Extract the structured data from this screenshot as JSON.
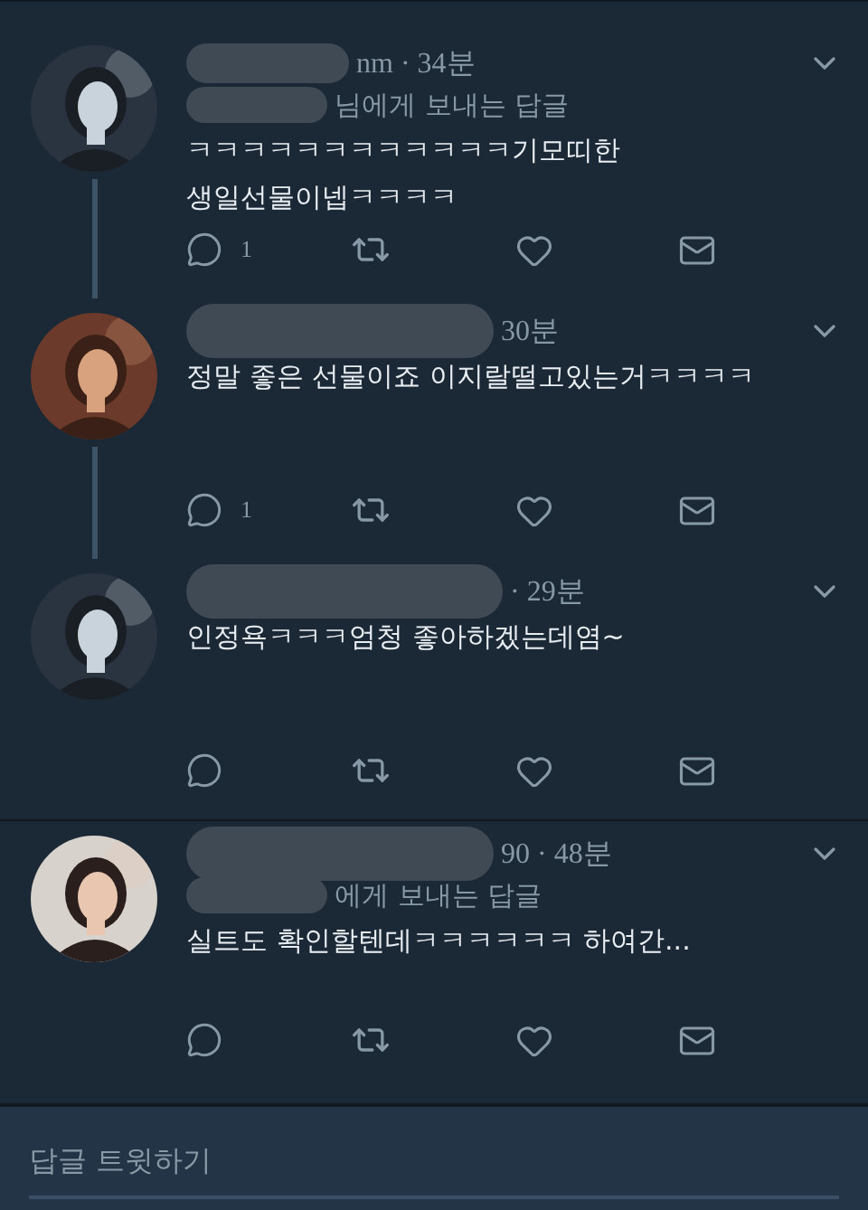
{
  "conversations": [
    {
      "tweets": [
        {
          "meta": "nm · 34분",
          "reply_to": "님에게 보내는 답글",
          "text": "ㅋㅋㅋㅋㅋㅋㅋㅋㅋㅋㅋㅋ기모띠한\n생일선물이넵ㅋㅋㅋㅋ",
          "reply_count": "1"
        },
        {
          "meta": "30분",
          "text": "정말 좋은 선물이죠 이지랄떨고있는거ㅋㅋㅋㅋ",
          "reply_count": "1"
        },
        {
          "meta": "· 29분",
          "text": "인정욕ㅋㅋㅋ엄청 좋아하겠는데염~"
        }
      ]
    },
    {
      "tweets": [
        {
          "meta": "90 · 48분",
          "reply_to": "에게 보내는 답글",
          "text": "실트도 확인할텐데ㅋㅋㅋㅋㅋㅋ 하여간..."
        }
      ]
    }
  ],
  "compose": {
    "placeholder": "답글 트윗하기"
  }
}
